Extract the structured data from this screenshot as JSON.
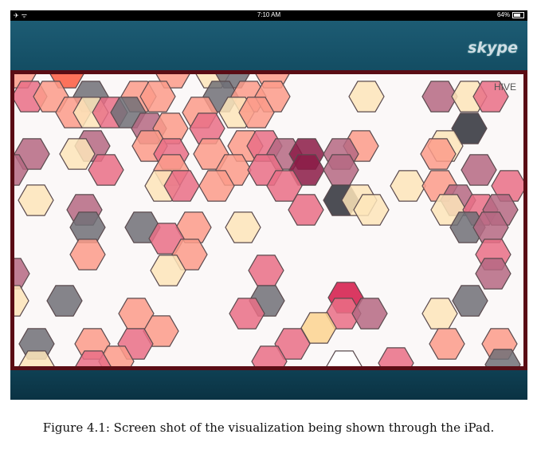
{
  "status_bar": {
    "left_icons": [
      "airplane-icon",
      "wifi-icon"
    ],
    "time": "7:10 AM",
    "battery": "64%"
  },
  "app_bar": {
    "logo": "skype"
  },
  "viz": {
    "label": "HIVE"
  },
  "caption": "Figure 4.1: Screen shot of the visualization being shown through the iPad.",
  "colors": {
    "frame": "#5a0d15",
    "app_bar": "#1d5c74",
    "bottom_bar": "#0f4053",
    "background": "#fbf8f8"
  }
}
